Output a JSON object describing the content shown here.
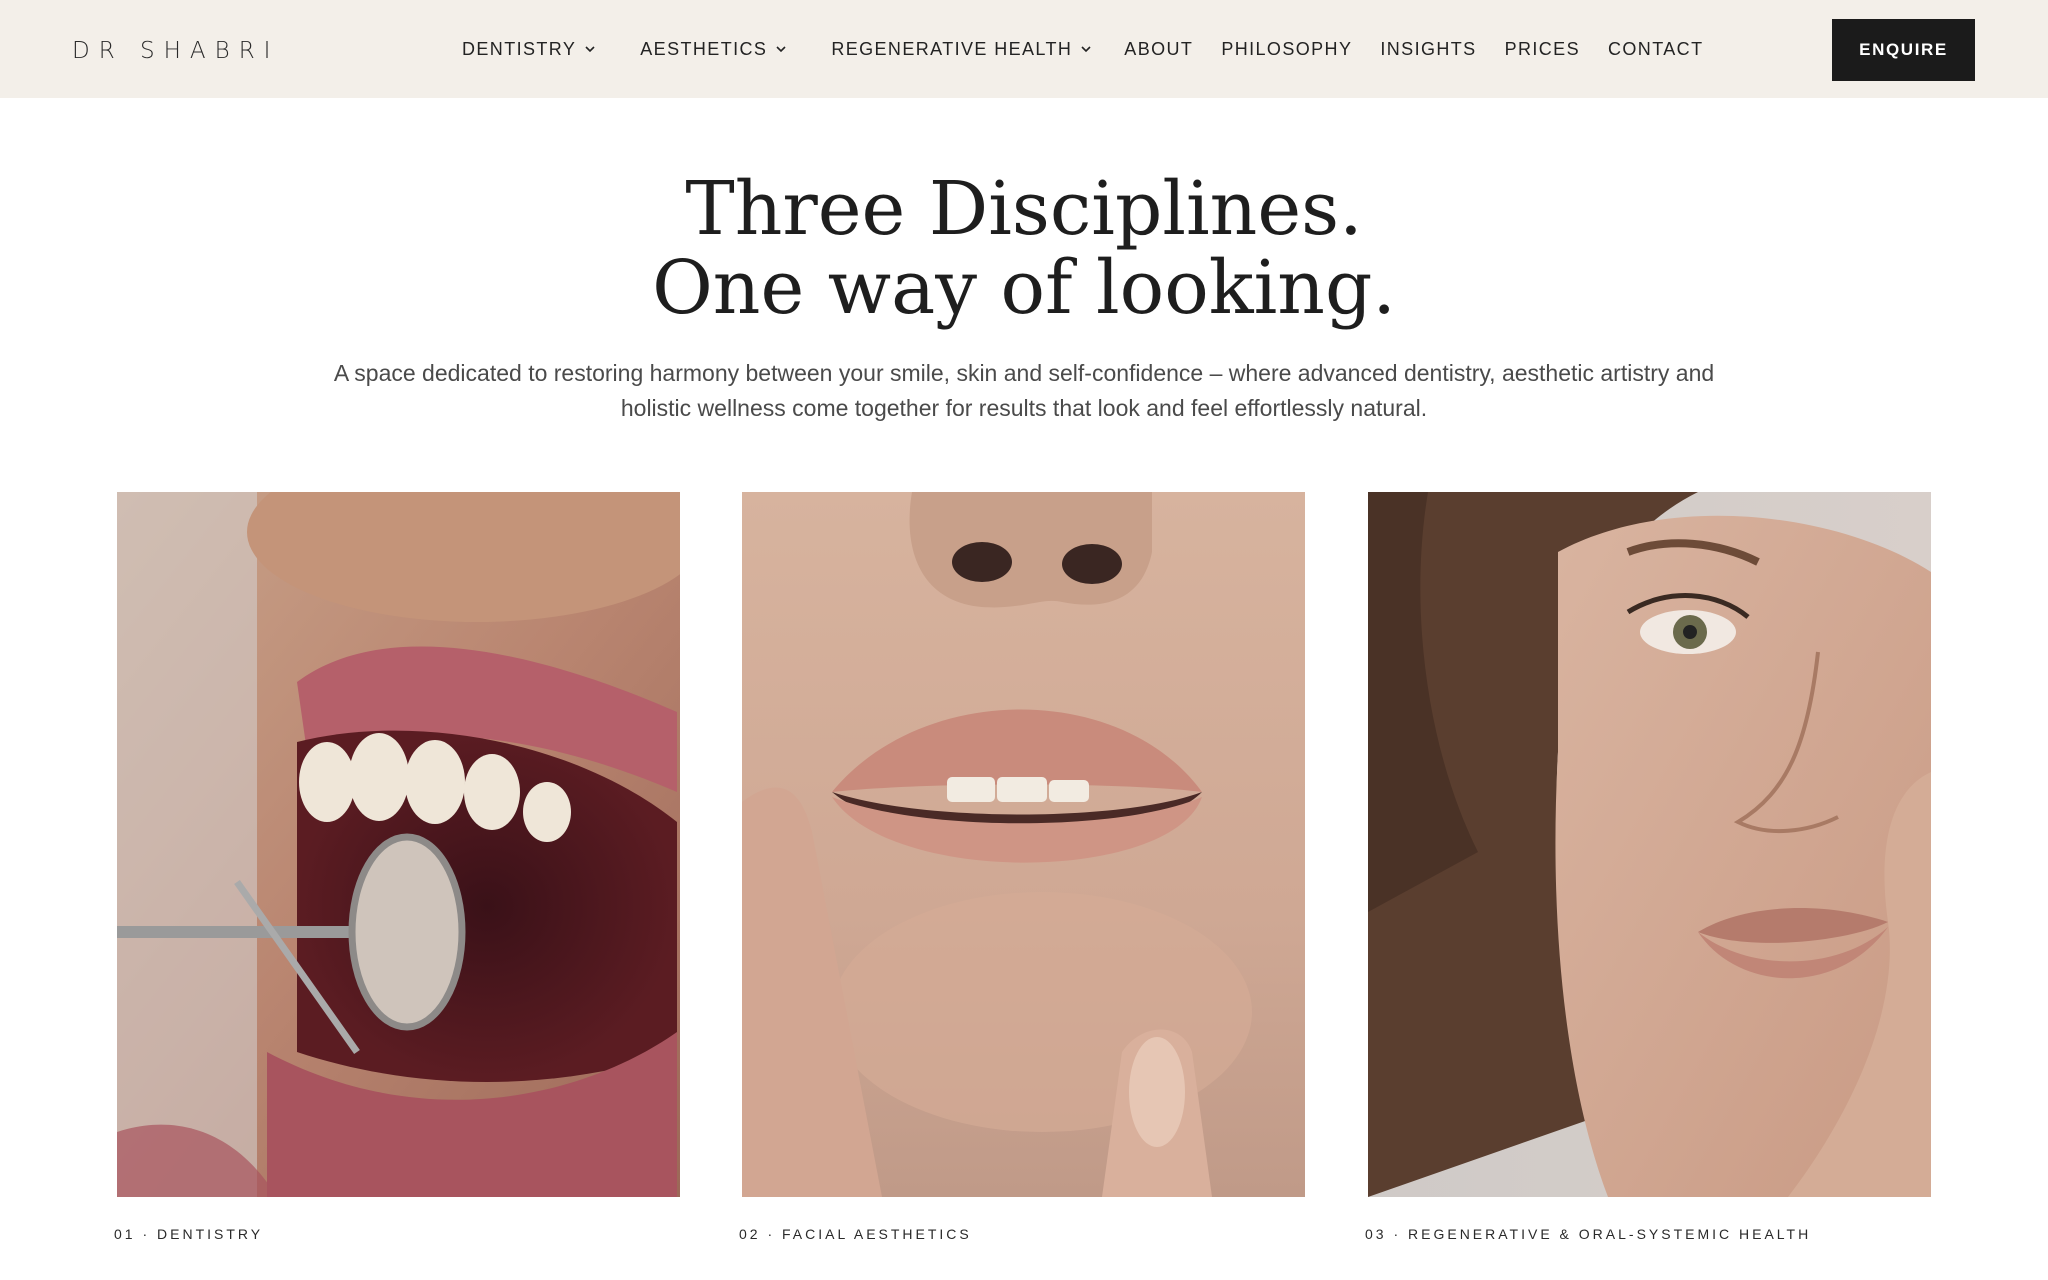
{
  "brand": {
    "logo_text": "DR SHABRI"
  },
  "nav": {
    "items": [
      {
        "label": "DENTISTRY",
        "has_dropdown": true
      },
      {
        "label": "AESTHETICS",
        "has_dropdown": true
      },
      {
        "label": "REGENERATIVE HEALTH",
        "has_dropdown": true
      },
      {
        "label": "ABOUT",
        "has_dropdown": false
      },
      {
        "label": "PHILOSOPHY",
        "has_dropdown": false
      },
      {
        "label": "INSIGHTS",
        "has_dropdown": false
      },
      {
        "label": "PRICES",
        "has_dropdown": false
      },
      {
        "label": "CONTACT",
        "has_dropdown": false
      }
    ],
    "cta_label": "ENQUIRE",
    "icons": {
      "dropdown": "chevron-down-icon"
    }
  },
  "hero": {
    "title_line1": "Three Disciplines.",
    "title_line2": "One way of looking.",
    "subtitle": "A space dedicated to restoring harmony between your smile, skin and self-confidence – where advanced dentistry, aesthetic artistry and holistic wellness come together for results that look and feel effortlessly natural."
  },
  "cards": [
    {
      "label": "01 · DENTISTRY",
      "image": "dental-mirror-smile-photo"
    },
    {
      "label": "02 · FACIAL AESTHETICS",
      "image": "lips-closeup-photo"
    },
    {
      "label": "03 · REGENERATIVE & ORAL-SYSTEMIC HEALTH",
      "image": "woman-portrait-photo"
    }
  ],
  "colors": {
    "header_bg": "#f3efe9",
    "cta_bg": "#1b1b1b",
    "text": "#1c1c1c"
  }
}
